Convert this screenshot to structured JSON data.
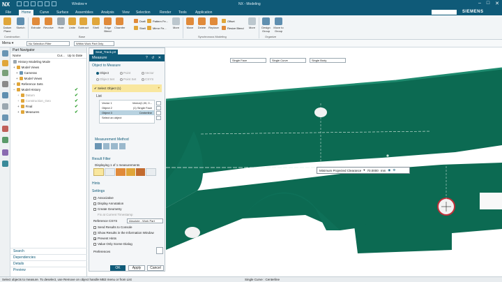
{
  "titlebar": {
    "logo": "NX",
    "window_menu": "Window ▾",
    "title": "NX - Modeling"
  },
  "menu_tabs": [
    "File",
    "Home",
    "Curve",
    "Surface",
    "Assemblies",
    "Analysis",
    "View",
    "Selection",
    "Render",
    "Tools",
    "Application"
  ],
  "active_tab": "Home",
  "brand": "SIEMENS",
  "ribbon": {
    "buttons": [
      {
        "label": "Datum Plane",
        "color": "#e0a63a"
      },
      {
        "label": "Sketch",
        "color": "#5f8fb0"
      },
      {
        "label": "Extrude",
        "color": "#e08a3a"
      },
      {
        "label": "Revolve",
        "color": "#e08a3a"
      },
      {
        "label": "Hole",
        "color": "#9aa7b0"
      },
      {
        "label": "Unite",
        "color": "#e0a63a"
      },
      {
        "label": "Subtract",
        "color": "#e0a63a"
      },
      {
        "label": "Shell",
        "color": "#e0a63a"
      },
      {
        "label": "Edge Blend",
        "color": "#e08a3a"
      },
      {
        "label": "Chamfer",
        "color": "#e08a3a"
      }
    ],
    "small_tools": [
      "Draft",
      "Pattern Fe...",
      "Shell",
      "Mirror Fe...",
      "More",
      "Move",
      "Delete",
      "Replace",
      "Offset",
      "Resize Blend",
      "More",
      "Design Group",
      "Move to Group"
    ],
    "groups": [
      "Construction",
      "Base",
      "Synchronous Modeling",
      "Organize"
    ]
  },
  "selection_bar": {
    "menu_label": "Menu ▾",
    "filter": "No Selection Filter",
    "scope": "Within Work Part Only"
  },
  "part_navigator": {
    "title": "Part Navigator",
    "columns": [
      "Name",
      "Cur...",
      "Up to Date"
    ],
    "items": [
      {
        "label": "History Modeling Mode",
        "check": ""
      },
      {
        "label": "Model Views",
        "check": ""
      },
      {
        "label": "Cameras",
        "check": ""
      },
      {
        "label": "Model Views",
        "check": ""
      },
      {
        "label": "Reference Sets",
        "check": ""
      },
      {
        "label": "Model History",
        "check": "✔"
      },
      {
        "label": "Datum",
        "check": "✔"
      },
      {
        "label": "Construction_Geo",
        "check": "✔"
      },
      {
        "label": "Final",
        "check": "✔"
      },
      {
        "label": "Measures",
        "check": "✔"
      }
    ],
    "bottom_panels": [
      "Search",
      "Dependencies",
      "Details",
      "Preview"
    ]
  },
  "dialog": {
    "doc_tab": "Seat_Track.prt",
    "title": "Measure",
    "title_buttons": "? ↺ ✕",
    "object_section": "Object to Measure",
    "object_types": [
      "Object",
      "Point",
      "Vector",
      "Object Set",
      "Point Set",
      "CSYS"
    ],
    "select_object": "Select Object (1)",
    "list_label": "List",
    "list_rows": [
      {
        "name": "Vector 1",
        "value": "Vector(1,00, 0..."
      },
      {
        "name": "Object 2",
        "value": "(1) Single Face"
      },
      {
        "name": "Object 3",
        "value": "Centerline"
      },
      {
        "name": "Select an object",
        "value": ""
      }
    ],
    "method_label": "Measurement Method",
    "result_filter": "Result Filter",
    "result_count": "Displaying 1 of 1 measurements",
    "hints": "Hints",
    "settings": "Settings",
    "options": [
      {
        "label": "Associative",
        "checked": false
      },
      {
        "label": "Display Annotation",
        "checked": false
      },
      {
        "label": "Create Geometry",
        "checked": false
      },
      {
        "label": "Fix at Current Timestamp",
        "checked": false
      }
    ],
    "reference_csys_label": "Reference CSYS",
    "reference_csys_value": "Absolute - Work Part",
    "options2": [
      {
        "label": "Send Results to Console",
        "checked": false
      },
      {
        "label": "Show Results in the Information Window",
        "checked": false
      },
      {
        "label": "Prevent Hints",
        "checked": true
      },
      {
        "label": "Value Only Scene Dialog",
        "checked": false
      }
    ],
    "preferences": "Preferences",
    "ok": "OK",
    "apply": "Apply",
    "cancel": "Cancel"
  },
  "graphics": {
    "filters": [
      "Single Face",
      "Single Curve",
      "Single Body"
    ],
    "measure_label": "Minimum Projected Clearance",
    "measure_value": "70.0000",
    "measure_unit": "mm",
    "part_color": "#0c6a52"
  },
  "status": {
    "left": "Select objects to measure. To deselect, use Remove on object handle MB3 menu or from List",
    "right": "Single Curve : Centerline"
  }
}
